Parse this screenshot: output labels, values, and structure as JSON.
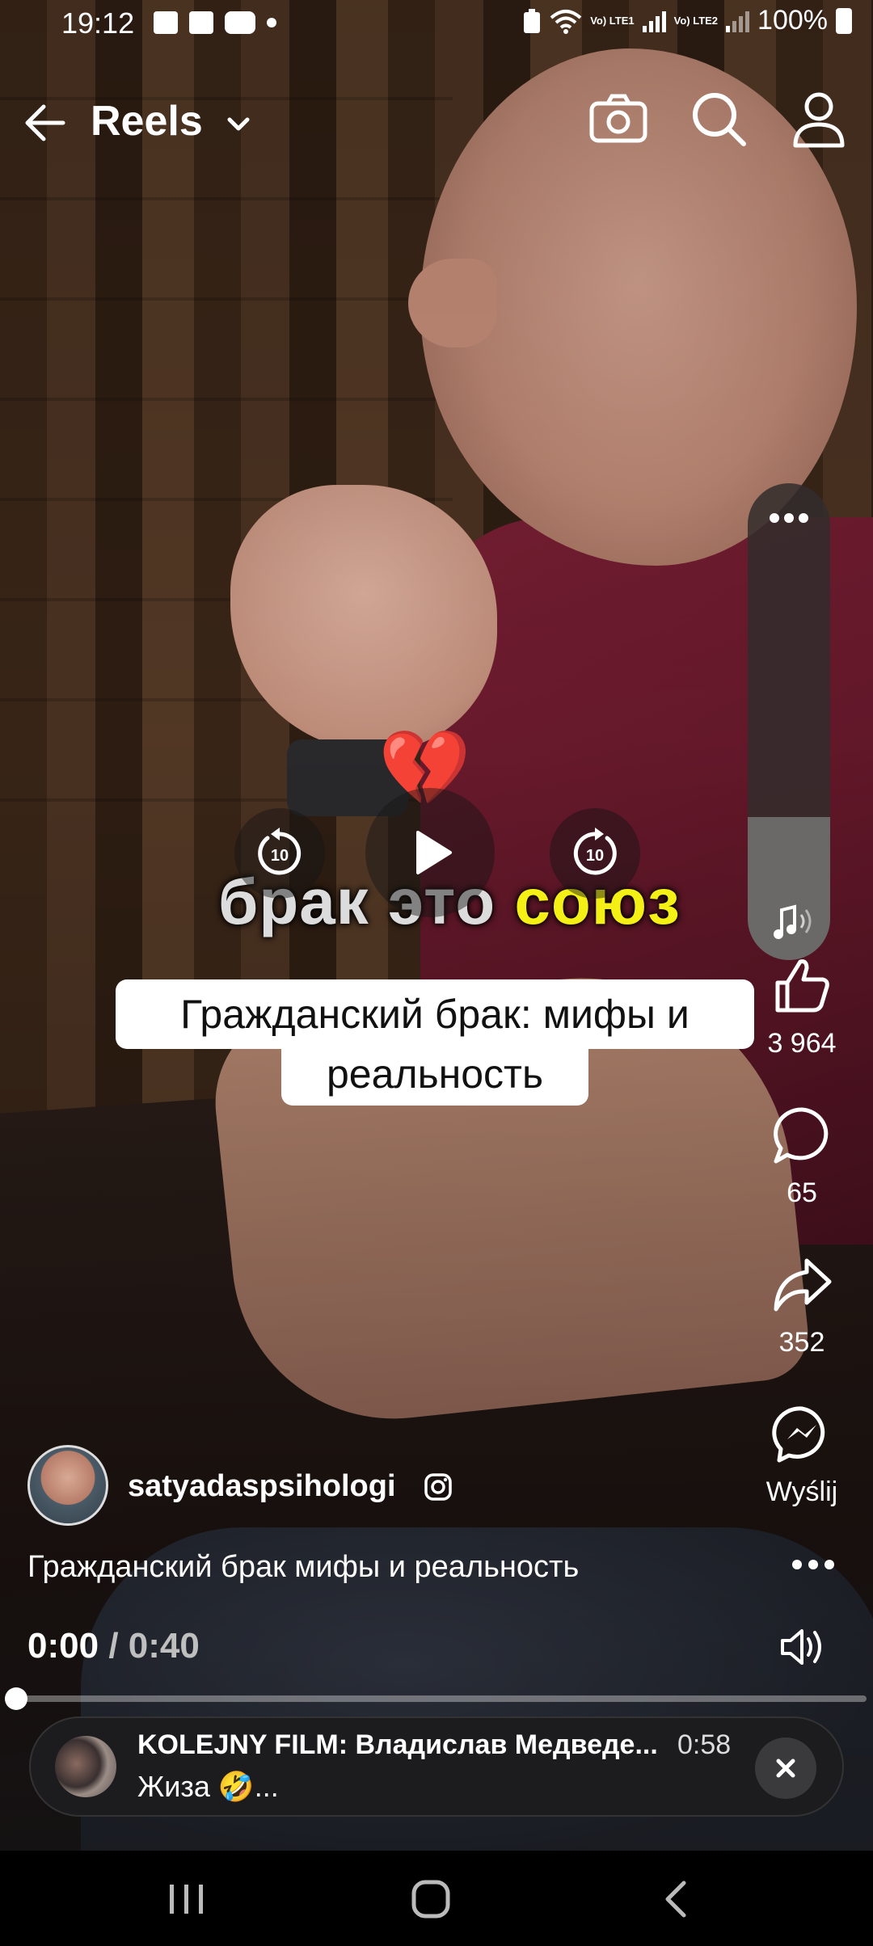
{
  "status_bar": {
    "time": "19:12",
    "network_1": "Vo) LTE1",
    "network_2": "Vo) LTE2",
    "battery": "100%"
  },
  "header": {
    "title": "Reels",
    "icons": [
      "camera-icon",
      "search-icon",
      "profile-icon"
    ]
  },
  "video": {
    "burned_text_white": "брак это ",
    "burned_text_yellow": "союз",
    "emoji": "💔",
    "caption_line1": "Гражданский брак: мифы  и",
    "caption_line2": "реальность",
    "controls": {
      "rewind_label": "10",
      "forward_label": "10"
    },
    "volume_level": 0.3
  },
  "actions": {
    "like_count": "3 964",
    "comment_count": "65",
    "share_count": "352",
    "send_label": "Wyślij"
  },
  "post": {
    "author": "satyadaspsihologi",
    "description": "Гражданский брак мифы и реальность",
    "time_current": "0:00",
    "time_separator": "/",
    "time_total": "0:40",
    "progress": 0.0
  },
  "mini_player": {
    "title": "KOLEJNY FILM: Владислав Медведе...",
    "duration": "0:58",
    "subtitle": "Жиза 🤣..."
  },
  "nav": [
    "recents-icon",
    "home-icon",
    "back-icon"
  ]
}
